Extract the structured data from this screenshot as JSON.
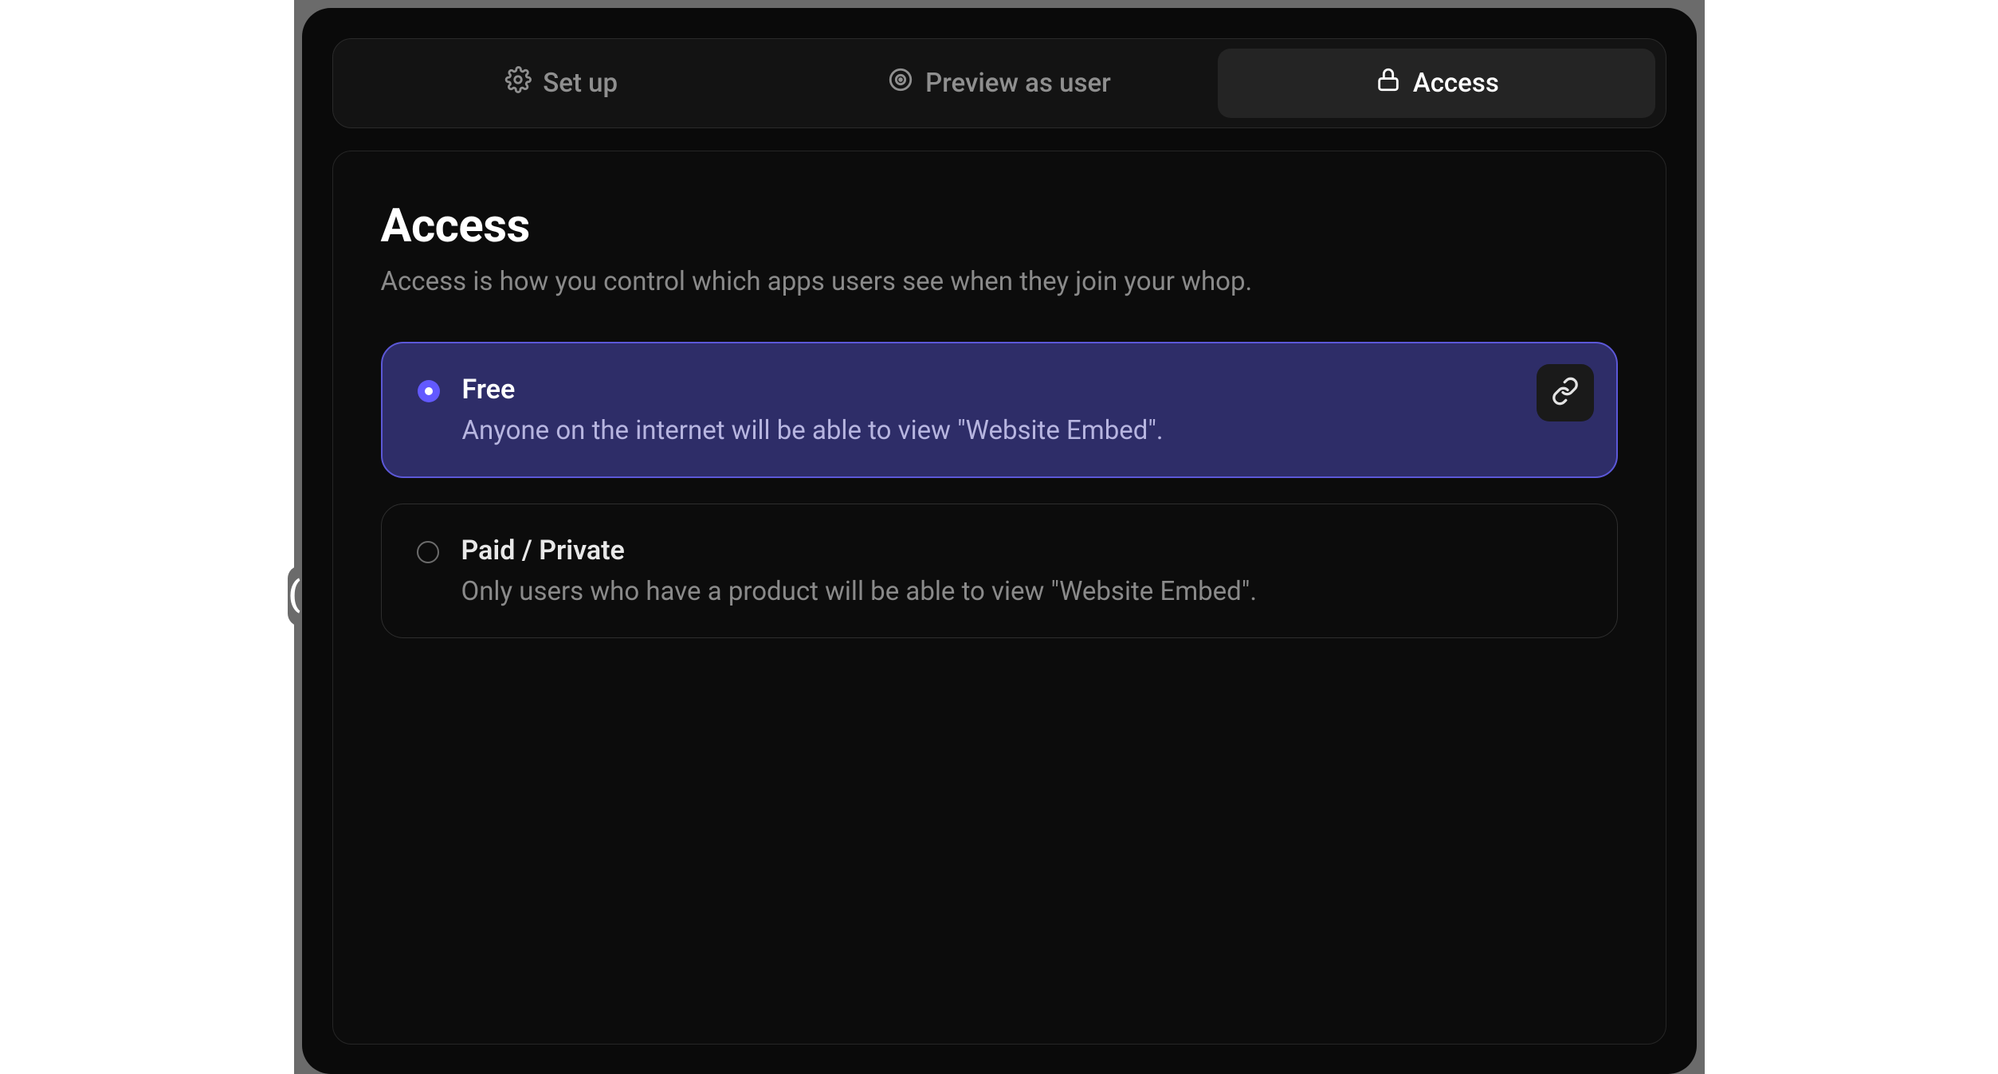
{
  "tabs": {
    "setup": {
      "label": "Set up"
    },
    "preview": {
      "label": "Preview as user"
    },
    "access": {
      "label": "Access"
    }
  },
  "panel": {
    "title": "Access",
    "subtitle": "Access is how you control which apps users see when they join your whop."
  },
  "options": {
    "free": {
      "title": "Free",
      "desc": "Anyone on the internet will be able to view \"Website Embed\"."
    },
    "paid": {
      "title": "Paid / Private",
      "desc": "Only users who have a product will be able to view \"Website Embed\"."
    }
  }
}
